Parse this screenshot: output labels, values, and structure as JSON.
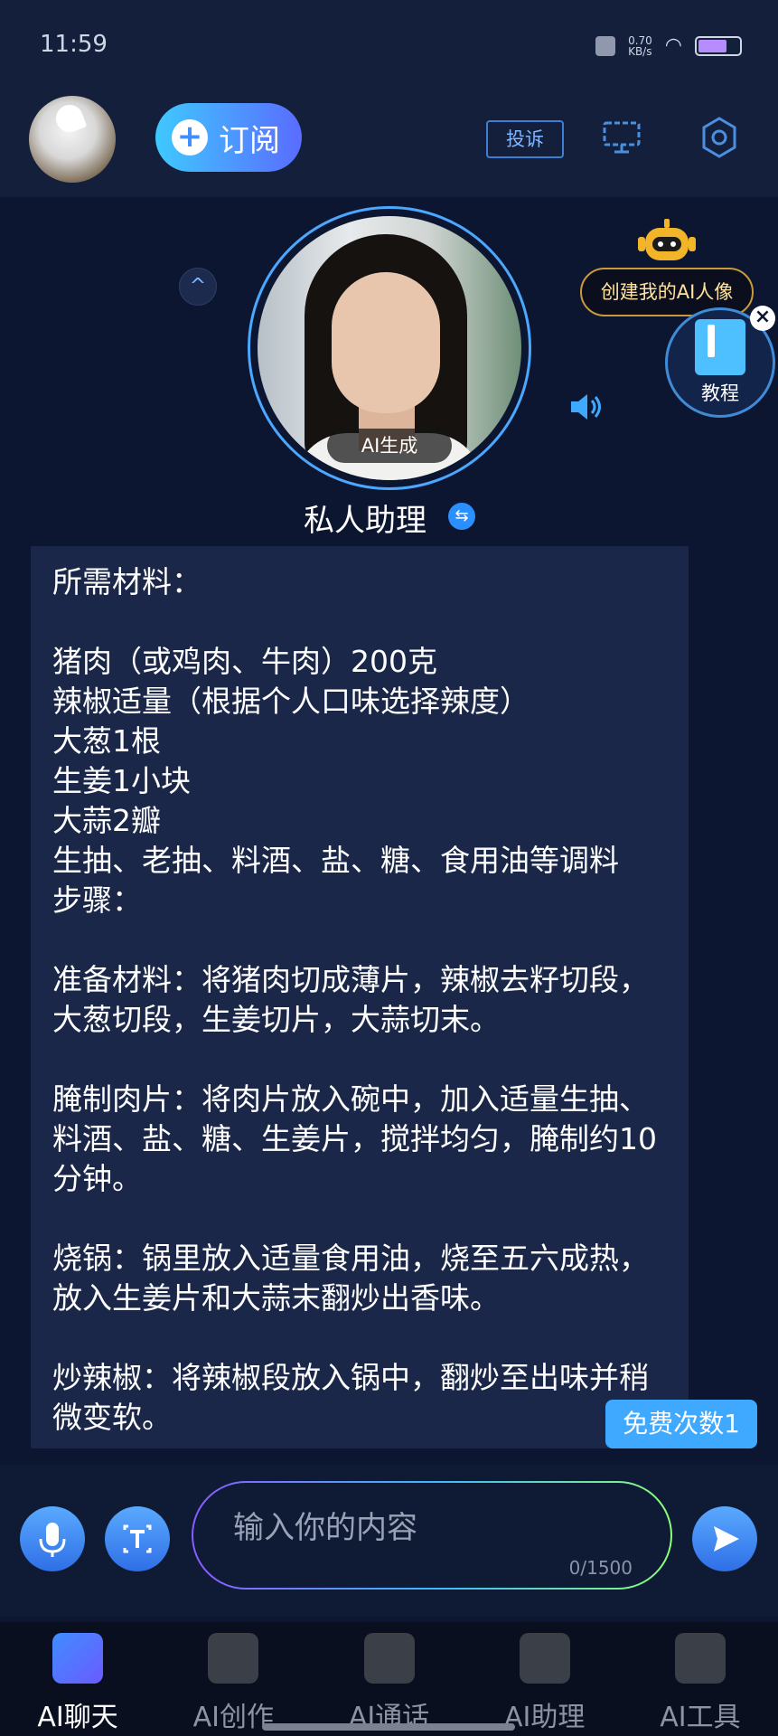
{
  "status_bar": {
    "time": "11:59",
    "network_speed": "0.70\nKB/s"
  },
  "header": {
    "subscribe_label": "订阅",
    "complain_label": "投诉"
  },
  "character": {
    "ai_badge": "AI生成",
    "name": "私人助理",
    "create_avatar_label": "创建我的AI人像",
    "tutorial_label": "教程"
  },
  "message": {
    "text": "所需材料：\n\n猪肉（或鸡肉、牛肉）200克\n辣椒适量（根据个人口味选择辣度）\n大葱1根\n生姜1小块\n大蒜2瓣\n生抽、老抽、料酒、盐、糖、食用油等调料\n步骤：\n\n准备材料：将猪肉切成薄片，辣椒去籽切段，大葱切段，生姜切片，大蒜切末。\n\n腌制肉片：将肉片放入碗中，加入适量生抽、料酒、盐、糖、生姜片，搅拌均匀，腌制约10分钟。\n\n烧锅：锅里放入适量食用油，烧至五六成热，放入生姜片和大蒜末翻炒出香味。\n\n炒辣椒：将辣椒段放入锅中，翻炒至出味并稍微变软。",
    "free_count_label": "免费次数1"
  },
  "input": {
    "placeholder": "输入你的内容",
    "char_count": "0/1500"
  },
  "bottom_nav": {
    "items": [
      {
        "label": "AI聊天"
      },
      {
        "label": "AI创作"
      },
      {
        "label": "AI通话"
      },
      {
        "label": "AI助理"
      },
      {
        "label": "AI工具"
      }
    ]
  },
  "colors": {
    "background": "#0d1631",
    "accent": "#3f8dff",
    "gold": "#c99a3a"
  }
}
